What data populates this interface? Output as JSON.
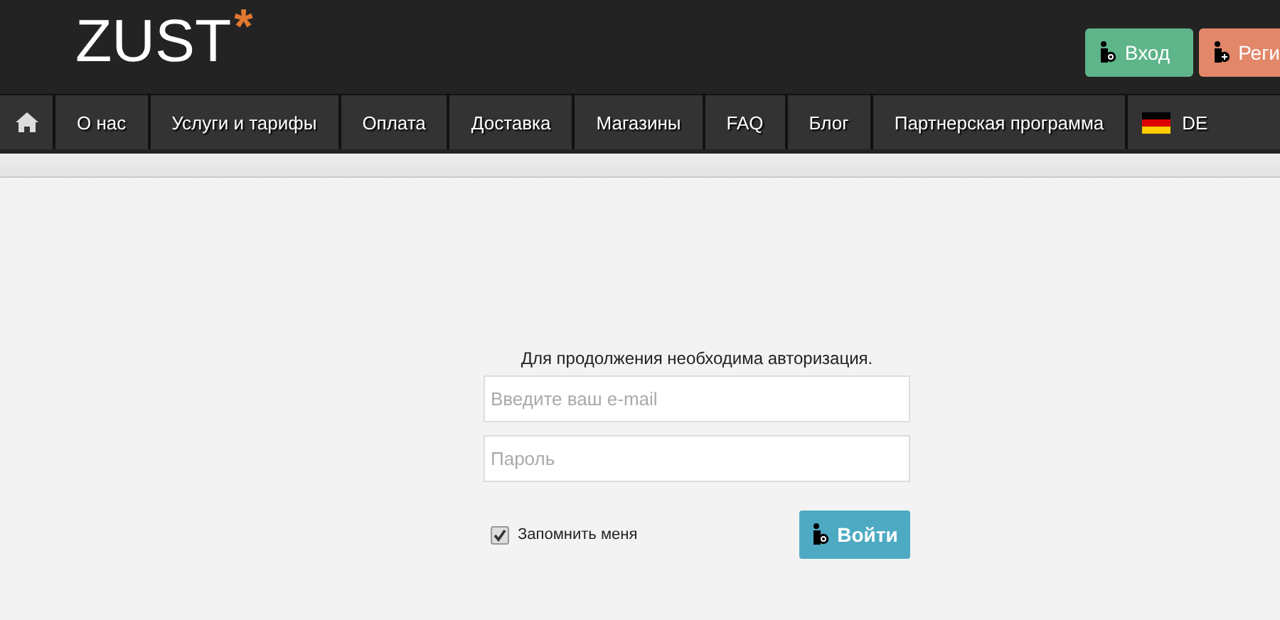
{
  "header": {
    "logo": "ZUST",
    "logo_mark": "*",
    "buttons": [
      {
        "label": "Вход",
        "kind": "login"
      },
      {
        "label": "Реги",
        "kind": "register"
      }
    ]
  },
  "nav": {
    "items": [
      {
        "label": "О нас",
        "kind": "link"
      },
      {
        "label": "Услуги и тарифы",
        "kind": "link"
      },
      {
        "label": "Оплата",
        "kind": "link"
      },
      {
        "label": "Доставка",
        "kind": "link"
      },
      {
        "label": "Магазины",
        "kind": "link"
      },
      {
        "label": "FAQ",
        "kind": "link"
      },
      {
        "label": "Блог",
        "kind": "link"
      },
      {
        "label": "Партнерская программа",
        "kind": "link"
      },
      {
        "label": "DE",
        "kind": "language"
      }
    ]
  },
  "login_form": {
    "message": "Для продолжения необходима авторизация.",
    "email": {
      "placeholder": "Введите ваш e-mail"
    },
    "password": {
      "placeholder": "Пароль"
    },
    "remember": {
      "label": "Запомнить меня",
      "checked": true
    },
    "submit": "Войти"
  }
}
